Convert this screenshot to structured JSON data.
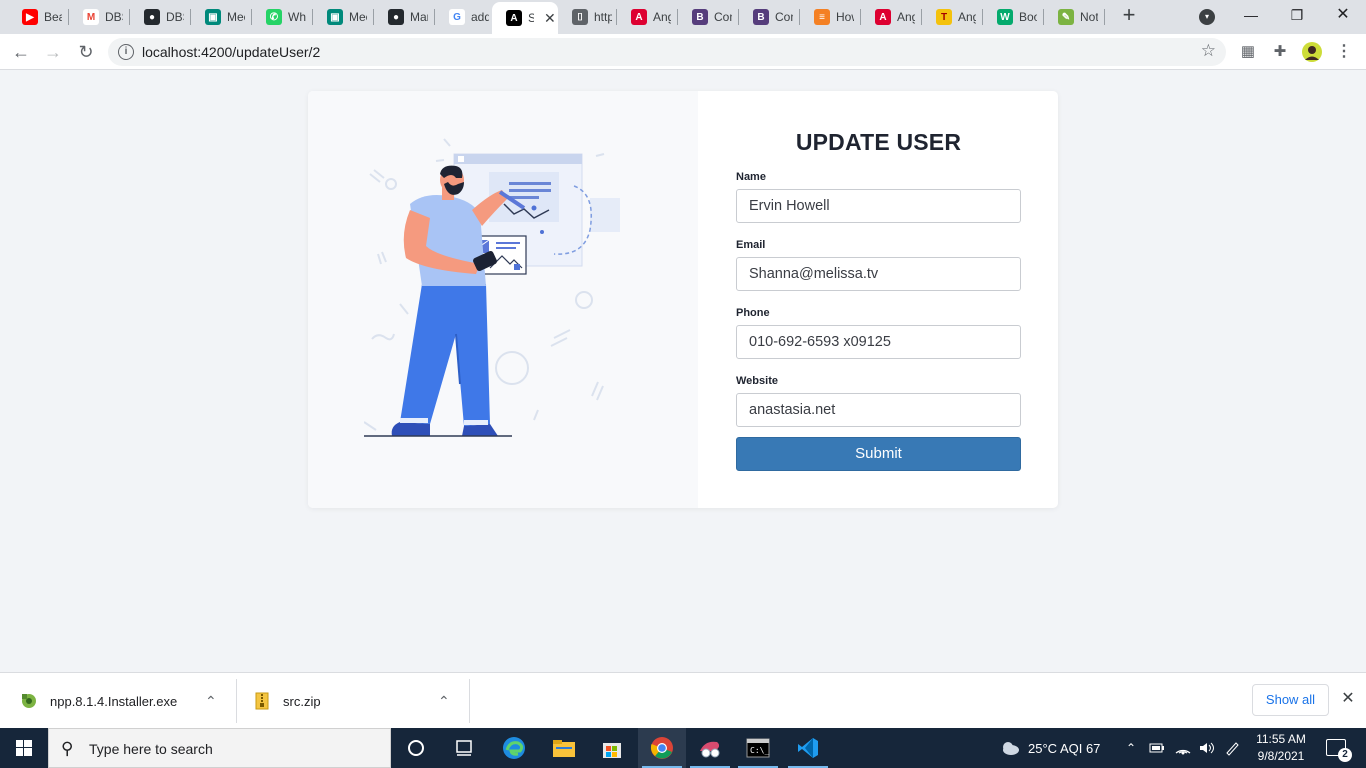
{
  "browser": {
    "tabs": [
      {
        "title": "Bea",
        "icon": "youtube-icon",
        "color": "#ff0000"
      },
      {
        "title": "DBS",
        "icon": "gmail-icon",
        "color": "#ea4335"
      },
      {
        "title": "DBS",
        "icon": "github-icon",
        "color": "#24292e"
      },
      {
        "title": "Mee",
        "icon": "google-meet-icon",
        "color": "#00897b"
      },
      {
        "title": "Wha",
        "icon": "whatsapp-icon",
        "color": "#25d366"
      },
      {
        "title": "Mee",
        "icon": "google-meet-icon",
        "color": "#00897b"
      },
      {
        "title": "Mar",
        "icon": "github-icon",
        "color": "#24292e"
      },
      {
        "title": "add",
        "icon": "google-icon",
        "color": "#4285f4"
      },
      {
        "title": "S",
        "icon": "angular-black-icon",
        "color": "#000000",
        "active": true
      },
      {
        "title": "http",
        "icon": "code-icon",
        "color": "#5f6368"
      },
      {
        "title": "Ang",
        "icon": "angular-icon",
        "color": "#dd0031"
      },
      {
        "title": "Con",
        "icon": "bootstrap-icon",
        "color": "#563d7c"
      },
      {
        "title": "Con",
        "icon": "bootstrap-icon",
        "color": "#563d7c"
      },
      {
        "title": "How",
        "icon": "stackoverflow-icon",
        "color": "#f48024"
      },
      {
        "title": "Ang",
        "icon": "angular-icon",
        "color": "#dd0031"
      },
      {
        "title": "Ang",
        "icon": "tek-icon",
        "color": "#f4c20d"
      },
      {
        "title": "Boo",
        "icon": "w3schools-icon",
        "color": "#04aa6d"
      },
      {
        "title": "Not",
        "icon": "notepad-icon",
        "color": "#7cb342"
      }
    ],
    "url": "localhost:4200/updateUser/2"
  },
  "form": {
    "heading": "UPDATE USER",
    "name_label": "Name",
    "name_value": "Ervin Howell",
    "email_label": "Email",
    "email_value": "Shanna@melissa.tv",
    "phone_label": "Phone",
    "phone_value": "010-692-6593 x09125",
    "website_label": "Website",
    "website_value": "anastasia.net",
    "submit_label": "Submit",
    "accent_color": "#3879b5"
  },
  "downloads": {
    "items": [
      {
        "name": "npp.8.1.4.Installer.exe",
        "icon": "npp-installer-icon"
      },
      {
        "name": "src.zip",
        "icon": "zip-file-icon"
      }
    ],
    "show_all": "Show all"
  },
  "taskbar": {
    "search_placeholder": "Type here to search",
    "weather": "25°C  AQI 67",
    "time": "11:55 AM",
    "date": "9/8/2021",
    "notifications": "2"
  }
}
